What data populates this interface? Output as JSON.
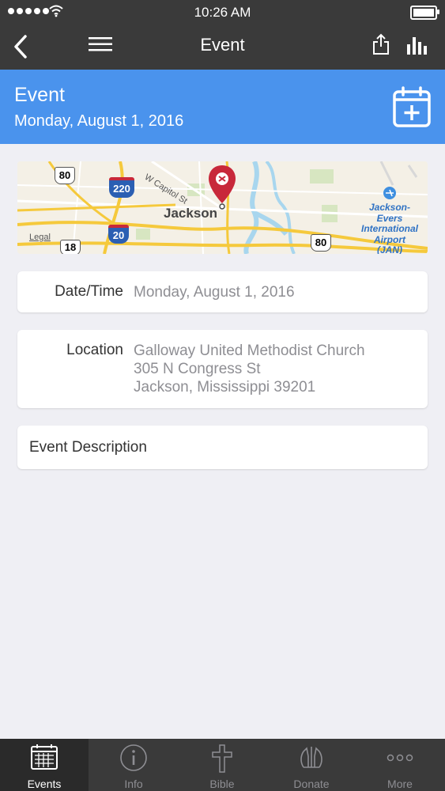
{
  "status": {
    "time": "10:26 AM"
  },
  "nav": {
    "title": "Event"
  },
  "header": {
    "title": "Event",
    "date": "Monday, August 1, 2016"
  },
  "map": {
    "city": "Jackson",
    "road_label": "W Capitol St",
    "legal": "Legal",
    "airport": [
      "Jackson-",
      "Evers",
      "International",
      "Airport",
      "(JAN)"
    ],
    "shields": [
      "80",
      "220",
      "20",
      "18",
      "80"
    ]
  },
  "details": {
    "datetime_label": "Date/Time",
    "datetime_value": "Monday, August 1, 2016",
    "location_label": "Location",
    "location_lines": [
      "Galloway United Methodist Church",
      "305 N Congress St",
      "Jackson, Mississippi 39201"
    ],
    "description_label": "Event Description"
  },
  "tabs": [
    {
      "label": "Events",
      "icon": "calendar-icon",
      "active": true
    },
    {
      "label": "Info",
      "icon": "info-icon"
    },
    {
      "label": "Bible",
      "icon": "cross-icon"
    },
    {
      "label": "Donate",
      "icon": "praying-hands-icon"
    },
    {
      "label": "More",
      "icon": "more-dots-icon"
    }
  ],
  "colors": {
    "bar": "#3a3a3a",
    "accent": "#4a93ed",
    "pin": "#c8283a",
    "background": "#efeff4"
  }
}
